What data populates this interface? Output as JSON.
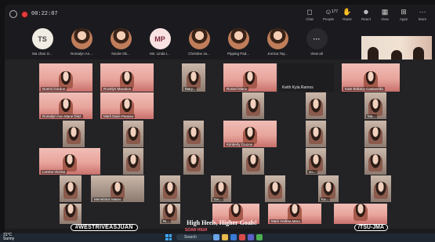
{
  "topbar": {
    "timer": "00:22:07",
    "tools": [
      {
        "icon": "chat-icon",
        "glyph": "◻",
        "label": "Chat"
      },
      {
        "icon": "people-icon",
        "glyph": "☺",
        "label": "People",
        "count": "177"
      },
      {
        "icon": "raise-hand-icon",
        "glyph": "✋",
        "label": "Raise"
      },
      {
        "icon": "react-icon",
        "glyph": "☻",
        "label": "React"
      },
      {
        "icon": "view-icon",
        "glyph": "▦",
        "label": "View"
      },
      {
        "icon": "apps-icon",
        "glyph": "⊞",
        "label": "Apps"
      },
      {
        "icon": "more-icon",
        "glyph": "⋯",
        "label": "More"
      }
    ]
  },
  "participants_strip": [
    {
      "initials": "TS",
      "name": "Ma chan G..."
    },
    {
      "initials": "",
      "name": "Romalyn An..."
    },
    {
      "initials": "",
      "name": "Nicole Ok..."
    },
    {
      "initials": "MP",
      "name": "Ms. Linda I..."
    },
    {
      "initials": "",
      "name": "Christine Ja..."
    },
    {
      "initials": "",
      "name": "Pipping Pad..."
    },
    {
      "initials": "",
      "name": "Jomica Tay..."
    },
    {
      "initials": "···",
      "name": "View all"
    }
  ],
  "grid_names": {
    "t1": "Noemi Gordon",
    "t2": "Rovelyn Marabon",
    "t3": "Mary...",
    "t4": "Russel Mario",
    "t5": "Keith Kyla Ramos",
    "t6": "Kate Brittany Castaneda",
    "t7": "Romalyn Ann Marie Diaz",
    "t8": "Mark Dave Paraiso",
    "t9": "Ma...",
    "t10": "Kimberly Cruzon",
    "t11": "Lorena Viceral",
    "t12": "Jo...",
    "t13": "Menelatos Mateo",
    "t14": "Ge...",
    "t15": "Mark Andrea Mero",
    "t16": "Ka...",
    "t17": "Ri..."
  },
  "overlay": {
    "hashtag": "#WESTRIVEASJUAN",
    "slogan": "High Heels, Higher Goals!",
    "slogan_sub": "SOAR HIGH",
    "handle": "/TSU-JMA"
  },
  "taskbar": {
    "temp": "31°C",
    "weather": "Sunny",
    "search": "Search"
  },
  "colors": {
    "accent": "#e53b3b",
    "tile_pink": "#e8a59c",
    "taskbar": "#1e2732"
  }
}
